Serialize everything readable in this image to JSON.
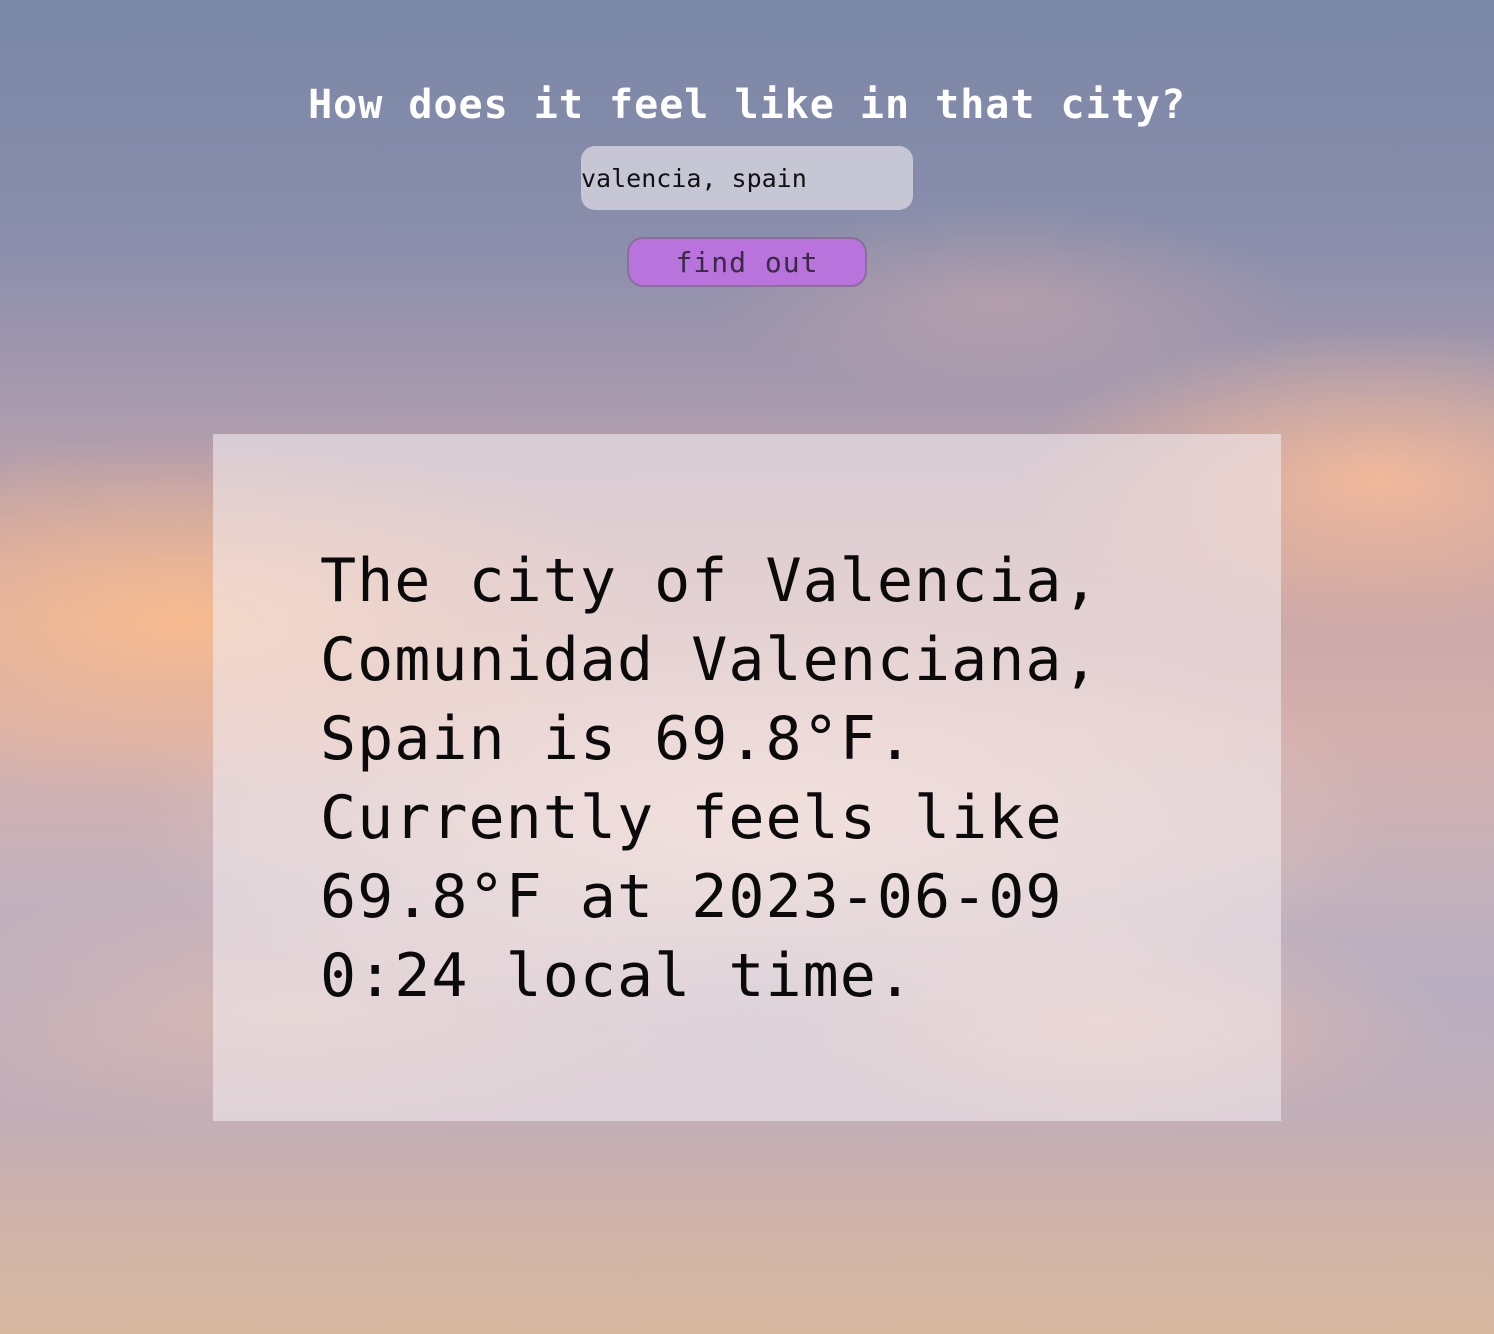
{
  "header": {
    "title": "How does it feel like in that city?"
  },
  "search": {
    "value": "valencia, spain",
    "placeholder": ""
  },
  "actions": {
    "find_label": "find out"
  },
  "result": {
    "text": "The city of Valencia,\nComunidad Valenciana,\nSpain is 69.8°F.\nCurrently feels like\n69.8°F at 2023-06-09\n0:24 local time."
  },
  "colors": {
    "button_bg": "#b873dc",
    "title_text": "#ffffff"
  }
}
